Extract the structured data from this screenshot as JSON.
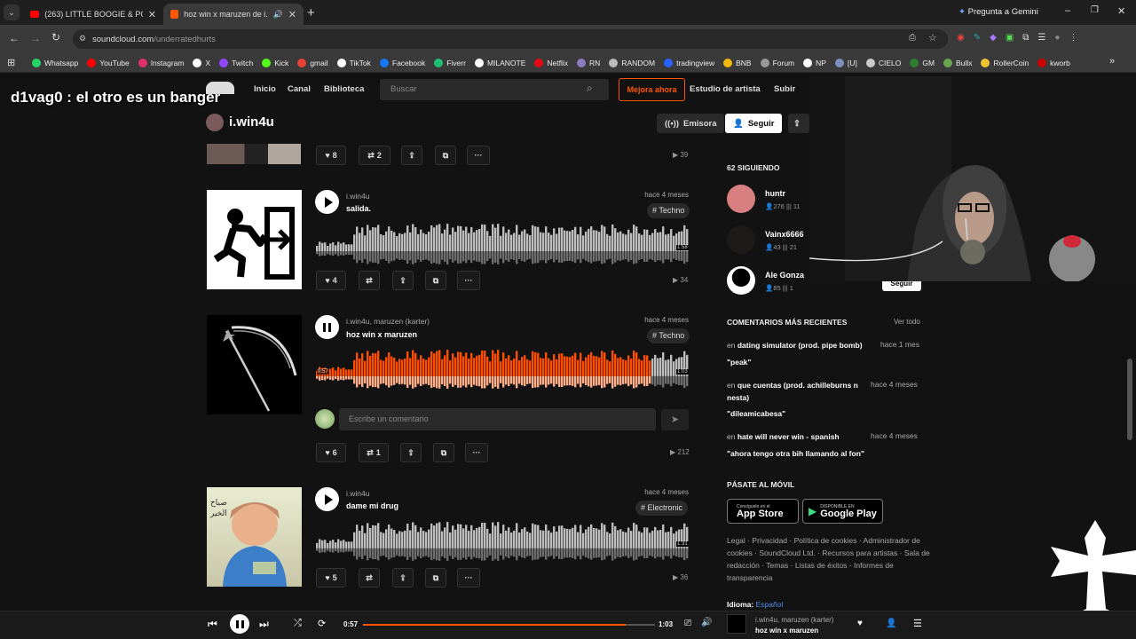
{
  "browser": {
    "tabs": [
      {
        "title": "(263) LITTLE BOOGIE & POST M"
      },
      {
        "title": "hoz win x maruzen de i.win4"
      }
    ],
    "gemini": "Pregunta a Gemini",
    "url_host": "soundcloud.com",
    "url_path": "/underratedhurts",
    "bookmarks": [
      "Whatsapp",
      "YouTube",
      "Instagram",
      "X",
      "Twitch",
      "Kick",
      "gmail",
      "TikTok",
      "Facebook",
      "Fiverr",
      "MILANOTE",
      "Netflix",
      "RN",
      "RANDOM",
      "tradingview",
      "BNB",
      "Forum",
      "NP",
      "[U]",
      "CIELO",
      "GM",
      "Bullx",
      "RollerCoin",
      "kworb"
    ],
    "bookmark_colors": [
      "#25d366",
      "#ff0000",
      "#e1306c",
      "#ffffff",
      "#9146ff",
      "#53fc18",
      "#ea4335",
      "#ffffff",
      "#1877f2",
      "#1dbf73",
      "#ffffff",
      "#e50914",
      "#8e7cc3",
      "#bbbbbb",
      "#2962ff",
      "#f0b90b",
      "#999999",
      "#ffffff",
      "#7f8fbf",
      "#cccccc",
      "#2e7d32",
      "#6aa84f",
      "#f1c232",
      "#cc0000"
    ]
  },
  "overlay_title": "d1vag0 : el otro es un banger",
  "header": {
    "nav": [
      "Inicio",
      "Canal",
      "Biblioteca"
    ],
    "search_placeholder": "Buscar",
    "upgrade": "Mejora ahora",
    "artist_studio": "Estudio de artista",
    "upload": "Subir"
  },
  "profile": {
    "name": "i.win4u",
    "station": "Emisora",
    "follow": "Seguir"
  },
  "top_row": {
    "likes": "8",
    "reposts": "2",
    "plays": "39"
  },
  "tracks": [
    {
      "artist": "i.win4u",
      "title": "salida.",
      "ago": "hace 4 meses",
      "tag": "# Techno",
      "duration": "1:58",
      "likes": "4",
      "reposts": "",
      "plays": "34",
      "progress": 0
    },
    {
      "artist": "i.win4u, maruzen (karter)",
      "title": "hoz win x maruzen",
      "ago": "hace 4 meses",
      "tag": "# Techno",
      "elapsed": "0:57",
      "duration": "1:03",
      "likes": "6",
      "reposts": "1",
      "plays": "212",
      "progress": 0.9,
      "comment_placeholder": "Escribe un comentario"
    },
    {
      "artist": "i.win4u",
      "title": "dame mi drug",
      "ago": "hace 4 meses",
      "tag": "# Electronic",
      "duration": "1:31",
      "likes": "5",
      "reposts": "",
      "plays": "36",
      "progress": 0
    }
  ],
  "sidebar": {
    "following_header": "62 SIGUIENDO",
    "following": [
      {
        "name": "huntr",
        "followers": "276",
        "tracks": "11"
      },
      {
        "name": "Vainx6666",
        "followers": "43",
        "tracks": "21"
      },
      {
        "name": "Ale Gonza",
        "followers": "85",
        "tracks": "1"
      }
    ],
    "follow_btn": "Seguir",
    "comments_header": "COMENTARIOS MÁS RECIENTES",
    "see_all": "Ver todo",
    "comments": [
      {
        "prefix": "en",
        "track": "dating simulator (prod. pipe bomb)",
        "ago": "hace 1 mes",
        "text": "\"peak\""
      },
      {
        "prefix": "en",
        "track": "que cuentas (prod. achilleburns n nesta)",
        "ago": "hace 4 meses",
        "text": "\"dileamicabesa\""
      },
      {
        "prefix": "en",
        "track": "hate will never win - spanish",
        "ago": "hace 4 meses",
        "text": "\"ahora tengo otra bih llamando al fon\""
      }
    ],
    "mobile_header": "PÁSATE AL MÓVIL",
    "appstore_small": "Consíguelo en el",
    "appstore": "App Store",
    "googleplay_small": "DISPONIBLE EN",
    "googleplay": "Google Play",
    "footer": "Legal · Privacidad · Política de cookies · Administrador de cookies · SoundCloud Ltd. · Recursos para artistas · Sala de redacción · Temas · Listas de éxitos · Informes de transparencia",
    "language_label": "Idioma:",
    "language": "Español"
  },
  "player": {
    "elapsed": "0:57",
    "duration": "1:03",
    "progress": 0.9,
    "artist": "i.win4u, maruzen (karter)",
    "title": "hoz win x maruzen"
  }
}
